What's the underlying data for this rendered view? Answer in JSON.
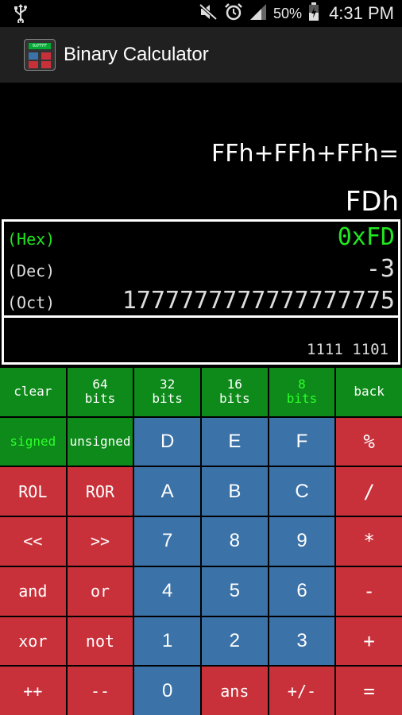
{
  "status_bar": {
    "battery": "50%",
    "time": "4:31 PM"
  },
  "app": {
    "title": "Binary Calculator",
    "icon_text": "0xFFFF"
  },
  "display": {
    "expression": "FFh+FFh+FFh=",
    "result": "FDh",
    "hex_label": "(Hex)",
    "hex_value": "0xFD",
    "dec_label": "(Dec)",
    "dec_value": "-3",
    "oct_label": "(Oct)",
    "oct_value": "1777777777777777775",
    "binary": "1111 1101"
  },
  "keypad": {
    "rows": [
      [
        {
          "label": "clear",
          "type": "green"
        },
        {
          "label": "64\nbits",
          "type": "green"
        },
        {
          "label": "32\nbits",
          "type": "green"
        },
        {
          "label": "16\nbits",
          "type": "green"
        },
        {
          "label": "8\nbits",
          "type": "green",
          "active": true
        },
        {
          "label": "back",
          "type": "green"
        }
      ],
      [
        {
          "label": "signed",
          "type": "green",
          "active": true
        },
        {
          "label": "unsigned",
          "type": "green"
        },
        {
          "label": "D",
          "type": "blue"
        },
        {
          "label": "E",
          "type": "blue"
        },
        {
          "label": "F",
          "type": "blue"
        },
        {
          "label": "%",
          "type": "red",
          "big": true
        }
      ],
      [
        {
          "label": "ROL",
          "type": "red"
        },
        {
          "label": "ROR",
          "type": "red"
        },
        {
          "label": "A",
          "type": "blue"
        },
        {
          "label": "B",
          "type": "blue"
        },
        {
          "label": "C",
          "type": "blue"
        },
        {
          "label": "/",
          "type": "red",
          "big": true
        }
      ],
      [
        {
          "label": "<<",
          "type": "red"
        },
        {
          "label": ">>",
          "type": "red"
        },
        {
          "label": "7",
          "type": "blue"
        },
        {
          "label": "8",
          "type": "blue"
        },
        {
          "label": "9",
          "type": "blue"
        },
        {
          "label": "*",
          "type": "red",
          "big": true
        }
      ],
      [
        {
          "label": "and",
          "type": "red"
        },
        {
          "label": "or",
          "type": "red"
        },
        {
          "label": "4",
          "type": "blue"
        },
        {
          "label": "5",
          "type": "blue"
        },
        {
          "label": "6",
          "type": "blue"
        },
        {
          "label": "-",
          "type": "red",
          "big": true
        }
      ],
      [
        {
          "label": "xor",
          "type": "red"
        },
        {
          "label": "not",
          "type": "red"
        },
        {
          "label": "1",
          "type": "blue"
        },
        {
          "label": "2",
          "type": "blue"
        },
        {
          "label": "3",
          "type": "blue"
        },
        {
          "label": "+",
          "type": "red",
          "big": true
        }
      ],
      [
        {
          "label": "++",
          "type": "red"
        },
        {
          "label": "--",
          "type": "red"
        },
        {
          "label": "0",
          "type": "blue"
        },
        {
          "label": "ans",
          "type": "red"
        },
        {
          "label": "+/-",
          "type": "red"
        },
        {
          "label": "=",
          "type": "red",
          "big": true
        }
      ]
    ]
  },
  "colors": {
    "green_key": "#0d8a19",
    "blue_key": "#3b72a8",
    "red_key": "#c9313a",
    "hex_text": "#1fe81f"
  }
}
